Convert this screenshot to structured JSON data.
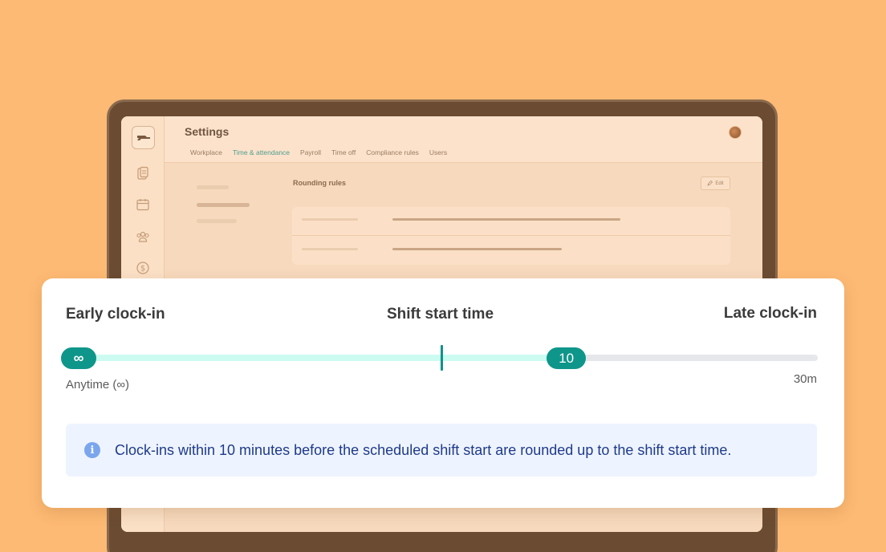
{
  "app": {
    "title": "Settings",
    "tabs": [
      {
        "label": "Workplace",
        "active": false
      },
      {
        "label": "Time & attendance",
        "active": true
      },
      {
        "label": "Payroll",
        "active": false
      },
      {
        "label": "Time off",
        "active": false
      },
      {
        "label": "Compliance rules",
        "active": false
      },
      {
        "label": "Users",
        "active": false
      }
    ],
    "section_title": "Rounding rules",
    "edit_label": "Edit",
    "sidebar_icons": [
      "logo-icon",
      "clipboard-icon",
      "calendar-icon",
      "team-icon",
      "dollar-icon"
    ]
  },
  "rounding": {
    "early_label": "Early clock-in",
    "center_label": "Shift start time",
    "late_label": "Late clock-in",
    "early_handle": "∞",
    "late_handle": "10",
    "early_caption": "Anytime (∞)",
    "late_caption": "30m",
    "late_value_minutes": 10,
    "late_max_minutes": 30,
    "info_text": "Clock-ins within 10 minutes before the scheduled shift start are rounded up to the shift start time.",
    "info_icon": "info-icon"
  },
  "colors": {
    "background": "#FDBA74",
    "accent": "#0F968A",
    "track_fill": "#CCFBF1",
    "info_bg": "#EEF4FF",
    "info_text": "#1E3A8A"
  }
}
